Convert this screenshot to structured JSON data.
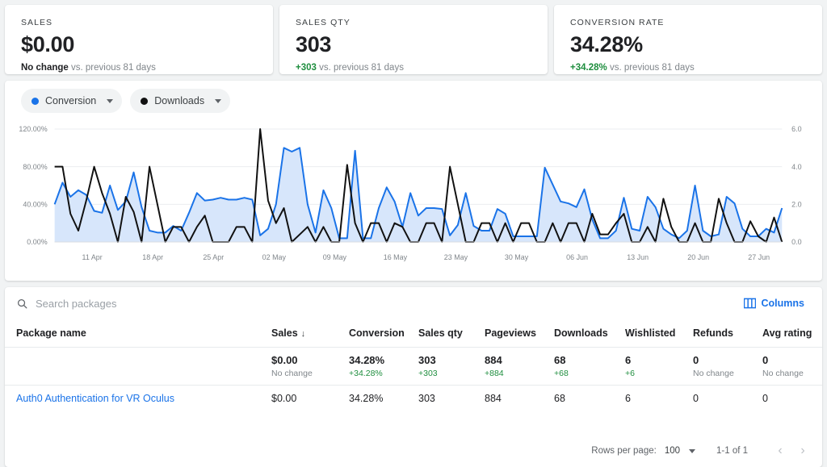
{
  "kpis": [
    {
      "label": "SALES",
      "value": "$0.00",
      "delta": "No change",
      "delta_positive": false,
      "comparison": "vs. previous 81 days"
    },
    {
      "label": "SALES QTY",
      "value": "303",
      "delta": "+303",
      "delta_positive": true,
      "comparison": "vs. previous 81 days"
    },
    {
      "label": "CONVERSION RATE",
      "value": "34.28%",
      "delta": "+34.28%",
      "delta_positive": true,
      "comparison": "vs. previous 81 days"
    }
  ],
  "chart_controls": {
    "series_a_label": "Conversion",
    "series_a_color": "#1a73e8",
    "series_b_label": "Downloads",
    "series_b_color": "#111111"
  },
  "table": {
    "search_placeholder": "Search packages",
    "search_value": "",
    "columns_label": "Columns",
    "headers": [
      "Package name",
      "Sales",
      "Conversion",
      "Sales qty",
      "Pageviews",
      "Downloads",
      "Wishlisted",
      "Refunds",
      "Avg rating"
    ],
    "sort_column": "Sales",
    "sort_direction": "desc",
    "sort_glyph": "↓",
    "summary_row": [
      {
        "value": "",
        "sub": "",
        "sub_positive": false
      },
      {
        "value": "$0.00",
        "sub": "No change",
        "sub_positive": false
      },
      {
        "value": "34.28%",
        "sub": "+34.28%",
        "sub_positive": true
      },
      {
        "value": "303",
        "sub": "+303",
        "sub_positive": true
      },
      {
        "value": "884",
        "sub": "+884",
        "sub_positive": true
      },
      {
        "value": "68",
        "sub": "+68",
        "sub_positive": true
      },
      {
        "value": "6",
        "sub": "+6",
        "sub_positive": true
      },
      {
        "value": "0",
        "sub": "No change",
        "sub_positive": false
      },
      {
        "value": "0",
        "sub": "No change",
        "sub_positive": false
      }
    ],
    "rows": [
      {
        "package_name": "Auth0 Authentication for VR Oculus",
        "sales": "$0.00",
        "conversion": "34.28%",
        "sales_qty": "303",
        "pageviews": "884",
        "downloads": "68",
        "wishlisted": "6",
        "refunds": "0",
        "avg_rating": "0"
      }
    ]
  },
  "pagination": {
    "rows_per_page_label": "Rows per page:",
    "rows_per_page_value": "100",
    "range_label": "1-1 of 1",
    "prev_glyph": "‹",
    "next_glyph": "›"
  },
  "chart_data": {
    "type": "line",
    "title": "",
    "xlabel": "",
    "ylabel": "",
    "grid": true,
    "legend_position": "top-left",
    "x_tick_labels": [
      "11 Apr",
      "18 Apr",
      "25 Apr",
      "02 May",
      "09 May",
      "16 May",
      "23 May",
      "30 May",
      "06 Jun",
      "13 Jun",
      "20 Jun",
      "27 Jun"
    ],
    "y_left": {
      "label": "Conversion",
      "ticks": [
        "0.00%",
        "40.00%",
        "80.00%",
        "120.00%"
      ],
      "min": 0,
      "max": 120,
      "unit": "%"
    },
    "y_right": {
      "label": "Downloads",
      "ticks": [
        "0.0",
        "2.0",
        "4.0",
        "6.0"
      ],
      "min": 0,
      "max": 6,
      "unit": ""
    },
    "series": [
      {
        "name": "Conversion",
        "color": "#1a73e8",
        "axis": "left",
        "filled": true,
        "fill_color": "#d7e6fb",
        "values": [
          40,
          63,
          48,
          55,
          50,
          33,
          31,
          60,
          34,
          43,
          74,
          37,
          12,
          10,
          10,
          17,
          12,
          31,
          52,
          44,
          45,
          47,
          45,
          45,
          47,
          45,
          7,
          14,
          40,
          100,
          96,
          100,
          40,
          10,
          55,
          36,
          4,
          4,
          97,
          4,
          4,
          36,
          58,
          43,
          16,
          52,
          28,
          36,
          36,
          35,
          7,
          18,
          52,
          17,
          12,
          12,
          35,
          30,
          6,
          6,
          6,
          6,
          79,
          61,
          43,
          41,
          37,
          56,
          24,
          4,
          4,
          12,
          47,
          14,
          12,
          48,
          37,
          14,
          8,
          4,
          12,
          60,
          12,
          6,
          8,
          48,
          41,
          14,
          6,
          6,
          14,
          10,
          36
        ]
      },
      {
        "name": "Downloads",
        "color": "#111111",
        "axis": "right",
        "filled": false,
        "values": [
          4.0,
          4.0,
          1.5,
          0.6,
          2.2,
          4.0,
          2.6,
          1.5,
          0.0,
          2.4,
          1.6,
          0.0,
          4.0,
          2.0,
          0.0,
          0.8,
          0.8,
          0.0,
          0.8,
          1.4,
          0.0,
          0.0,
          0.0,
          0.8,
          0.8,
          0.0,
          6.0,
          2.2,
          1.0,
          1.8,
          0.0,
          0.4,
          0.8,
          0.0,
          0.8,
          0.0,
          0.0,
          4.1,
          1.0,
          0.0,
          1.0,
          1.0,
          0.0,
          1.0,
          0.8,
          0.0,
          0.0,
          1.0,
          1.0,
          0.0,
          4.0,
          2.0,
          0.0,
          0.0,
          1.0,
          1.0,
          0.0,
          1.0,
          0.0,
          1.0,
          1.0,
          0.0,
          0.0,
          1.0,
          0.0,
          1.0,
          1.0,
          0.0,
          1.5,
          0.4,
          0.4,
          1.0,
          1.5,
          0.0,
          0.0,
          0.8,
          0.0,
          2.3,
          0.8,
          0.0,
          0.0,
          1.0,
          0.0,
          0.0,
          2.3,
          1.0,
          0.0,
          0.0,
          1.1,
          0.3,
          0.0,
          1.3,
          0.0
        ]
      }
    ]
  }
}
